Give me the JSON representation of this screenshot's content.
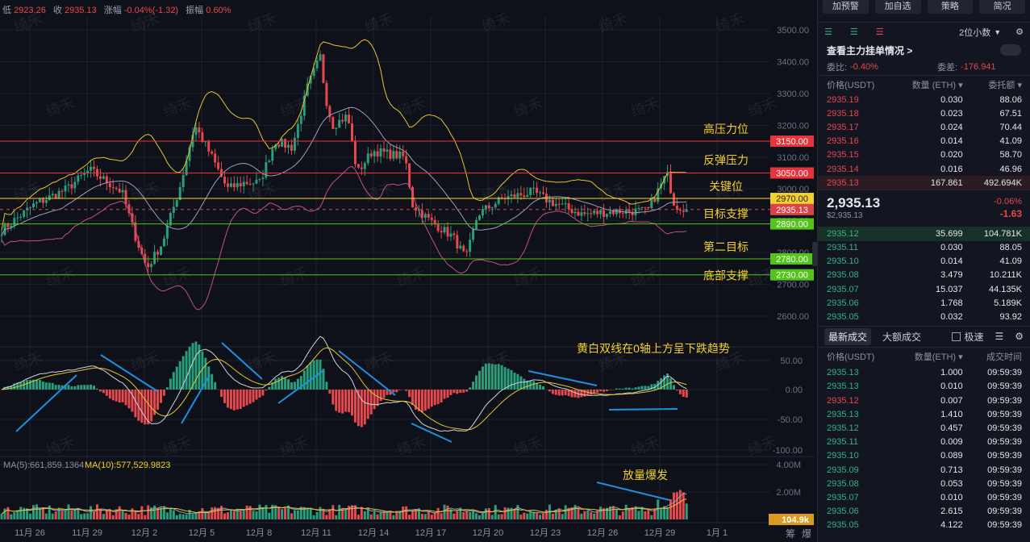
{
  "header": {
    "low_label": "低",
    "low": "2923.26",
    "close_label": "收",
    "close": "2935.13",
    "change_label": "涨幅",
    "change": "-0.04%(-1.32)",
    "amp_label": "振幅",
    "amp": "0.60%"
  },
  "watermark": "绮禾",
  "price_axis": [
    "3500.00",
    "3400.00",
    "3300.00",
    "3200.00",
    "3100.00",
    "3000.00",
    "2900.00",
    "2800.00",
    "2700.00",
    "2600.00"
  ],
  "levels": [
    {
      "price": 3150,
      "label": "3150.00",
      "color": "#e8323c",
      "note": "高压力位"
    },
    {
      "price": 3050,
      "label": "3050.00",
      "color": "#e8323c",
      "note": "反弹压力"
    },
    {
      "price": 2970,
      "label": "2970.00",
      "color": "#f2d12c",
      "note": "关键位"
    },
    {
      "price": 2935.13,
      "label": "2935.13",
      "color": "#d9434a",
      "note": "目标支撑"
    },
    {
      "price": 2890,
      "label": "2890.00",
      "color": "#52c41a",
      "note": ""
    },
    {
      "price": 2780,
      "label": "2780.00",
      "color": "#52c41a",
      "note": "第二目标"
    },
    {
      "price": 2730,
      "label": "2730.00",
      "color": "#52c41a",
      "note": "底部支撑"
    }
  ],
  "macd_axis": [
    "50.00",
    "0.00",
    "-50.00",
    "-100.00"
  ],
  "macd_note": "黄白双线在0轴上方呈下跌趋势",
  "volume": {
    "ma5": "MA(5):661,859.1364",
    "ma10": "MA(10):577,529.9823",
    "axis": [
      "4.00M",
      "2.00M"
    ],
    "current": "104.9k",
    "note": "放量爆发"
  },
  "dates": [
    "11月 26",
    "11月 29",
    "12月 2",
    "12月 5",
    "12月 8",
    "12月 11",
    "12月 14",
    "12月 17",
    "12月 20",
    "12月 23",
    "12月 26",
    "12月 29",
    "1月 1"
  ],
  "corner_labels": [
    "筹",
    "爆"
  ],
  "chart_data": {
    "type": "candlestick",
    "candles_per_day": 6,
    "start_day": "11月 24",
    "waypoints": [
      [
        0,
        2870
      ],
      [
        1.7,
        2950
      ],
      [
        3.4,
        3000
      ],
      [
        4.6,
        3060
      ],
      [
        6.3,
        2990
      ],
      [
        7,
        2850
      ],
      [
        7.6,
        2750
      ],
      [
        8.4,
        2830
      ],
      [
        9.3,
        3000
      ],
      [
        10.1,
        3200
      ],
      [
        11,
        3100
      ],
      [
        11.8,
        3000
      ],
      [
        12.7,
        3020
      ],
      [
        13.5,
        3020
      ],
      [
        14.3,
        3150
      ],
      [
        15.2,
        3130
      ],
      [
        16,
        3320
      ],
      [
        16.7,
        3420
      ],
      [
        16.9,
        3300
      ],
      [
        17.3,
        3200
      ],
      [
        18.1,
        3230
      ],
      [
        18.6,
        3050
      ],
      [
        19.4,
        3120
      ],
      [
        21.1,
        3100
      ],
      [
        21.5,
        2950
      ],
      [
        22.4,
        2900
      ],
      [
        23.6,
        2850
      ],
      [
        24.3,
        2780
      ],
      [
        24.9,
        2920
      ],
      [
        26.2,
        2970
      ],
      [
        27.8,
        2990
      ],
      [
        28.7,
        2960
      ],
      [
        30.4,
        2920
      ],
      [
        32.1,
        2930
      ],
      [
        33.8,
        2930
      ],
      [
        34.8,
        3050
      ],
      [
        35.2,
        2950
      ],
      [
        35.9,
        2935
      ]
    ]
  },
  "panel": {
    "buttons": [
      "加预警",
      "加自选",
      "策略",
      "简况"
    ],
    "decimals": "2位小数",
    "main_orders": "查看主力挂单情况 >",
    "ratio_label": "委比:",
    "ratio": "-0.40%",
    "diff_label": "委差:",
    "diff": "-176.941",
    "book_headers": [
      "价格(USDT)",
      "数量 (ETH) ▾",
      "委托额 ▾"
    ],
    "asks": [
      [
        "2935.19",
        "0.030",
        "88.06"
      ],
      [
        "2935.18",
        "0.023",
        "67.51"
      ],
      [
        "2935.17",
        "0.024",
        "70.44"
      ],
      [
        "2935.16",
        "0.014",
        "41.09"
      ],
      [
        "2935.15",
        "0.020",
        "58.70"
      ],
      [
        "2935.14",
        "0.016",
        "46.96"
      ],
      [
        "2935.13",
        "167.861",
        "492.694K"
      ]
    ],
    "last_price": "2,935.13",
    "last_usd": "$2,935.13",
    "last_pct": "-0.06%",
    "last_chg": "-1.63",
    "bids": [
      [
        "2935.12",
        "35.699",
        "104.781K"
      ],
      [
        "2935.11",
        "0.030",
        "88.05"
      ],
      [
        "2935.10",
        "0.014",
        "41.09"
      ],
      [
        "2935.08",
        "3.479",
        "10.211K"
      ],
      [
        "2935.07",
        "15.037",
        "44.135K"
      ],
      [
        "2935.06",
        "1.768",
        "5.189K"
      ],
      [
        "2935.05",
        "0.032",
        "93.92"
      ]
    ],
    "trade_tabs": [
      "最新成交",
      "大额成交"
    ],
    "fast_label": "极速",
    "trade_headers": [
      "价格(USDT)",
      "数量(ETH) ▾",
      "成交时间"
    ],
    "trades": [
      [
        "2935.13",
        "1.000",
        "09:59:39",
        "g"
      ],
      [
        "2935.13",
        "0.010",
        "09:59:39",
        "g"
      ],
      [
        "2935.12",
        "0.007",
        "09:59:39",
        "r"
      ],
      [
        "2935.13",
        "1.410",
        "09:59:39",
        "g"
      ],
      [
        "2935.12",
        "0.457",
        "09:59:39",
        "g"
      ],
      [
        "2935.11",
        "0.009",
        "09:59:39",
        "g"
      ],
      [
        "2935.10",
        "0.089",
        "09:59:39",
        "g"
      ],
      [
        "2935.09",
        "0.713",
        "09:59:39",
        "g"
      ],
      [
        "2935.08",
        "0.053",
        "09:59:39",
        "g"
      ],
      [
        "2935.07",
        "0.010",
        "09:59:39",
        "g"
      ],
      [
        "2935.06",
        "2.615",
        "09:59:39",
        "g"
      ],
      [
        "2935.05",
        "4.122",
        "09:59:39",
        "g"
      ]
    ]
  },
  "colors": {
    "up": "#2a9d7a",
    "down": "#e5484d",
    "boll": "#e6c430",
    "mid": "#9aa0b8",
    "lower": "#c0508a",
    "arrow": "#1e90e0"
  }
}
